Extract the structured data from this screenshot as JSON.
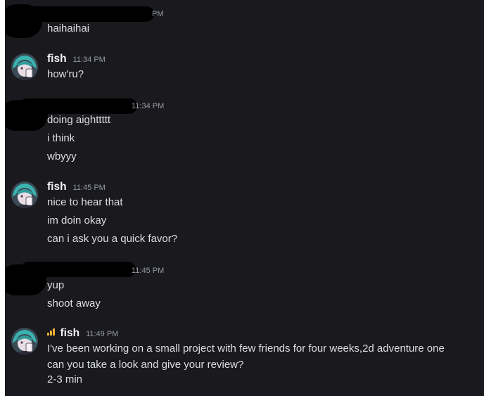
{
  "colors": {
    "background": "#1a1a1e",
    "username": "#f2f3f5",
    "text": "#dbdee1",
    "timestamp": "#949ba4",
    "signal": "#f0b232"
  },
  "messages": [
    {
      "author": "",
      "redacted": true,
      "timestamp": "PM",
      "lines": [
        "haihaihai"
      ]
    },
    {
      "author": "fish",
      "timestamp": "11:34 PM",
      "avatar_icon": "anime-avatar-icon",
      "lines": [
        "how'ru?"
      ]
    },
    {
      "author": "",
      "redacted": true,
      "timestamp": "11:34 PM",
      "lines": [
        "doing aighttttt",
        "i think",
        "wbyyy"
      ]
    },
    {
      "author": "fish",
      "timestamp": "11:45 PM",
      "avatar_icon": "anime-avatar-icon",
      "lines": [
        "nice to hear that",
        "im doin okay",
        "can i ask you a quick favor?"
      ]
    },
    {
      "author": "",
      "redacted": true,
      "timestamp": "11:45 PM",
      "lines": [
        "yup",
        "shoot away"
      ]
    },
    {
      "author": "fish",
      "timestamp": "11:49 PM",
      "avatar_icon": "anime-avatar-icon",
      "badge_icon": "signal-strength-icon",
      "lines": [
        "I've been working on a small project with few friends for four weeks,2d adventure one",
        "can you take a look and give your review?",
        "2-3 min"
      ]
    }
  ]
}
